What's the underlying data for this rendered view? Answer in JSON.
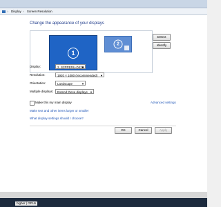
{
  "breadcrumb": {
    "items": [
      "Display",
      "Screen Resolution"
    ],
    "separator": "›"
  },
  "main": {
    "heading": "Change the appearance of your displays",
    "monitors": [
      {
        "number": "1",
        "selected": true
      },
      {
        "number": "2",
        "selected": false
      }
    ],
    "detect_label": "Detect",
    "identify_label": "Identify",
    "fields": {
      "display": {
        "label": "Display:",
        "value": "2. S2PPERU-D428"
      },
      "resolution": {
        "label": "Resolution:",
        "value": "1920 × 1080 (recommended)"
      },
      "orientation": {
        "label": "Orientation:",
        "value": "Landscape"
      },
      "multiple_displays": {
        "label": "Multiple displays:",
        "value": "Extend these displays"
      }
    },
    "main_display_label": "Make this my main display",
    "advanced_settings": "Advanced settings",
    "link_text_size": "Make text and other items larger or smaller",
    "link_display_settings": "What display settings should I choose?",
    "buttons": {
      "ok": "OK",
      "cancel": "Cancel",
      "apply": "Apply"
    }
  },
  "taskbar": {
    "label": "higher | GPUs"
  },
  "colors": {
    "heading": "#1e3a8a",
    "link": "#1c53b6",
    "selected_monitor": "#1f64c5",
    "secondary_monitor": "#5f8ed4",
    "taskbar": "#1c2a3d"
  }
}
